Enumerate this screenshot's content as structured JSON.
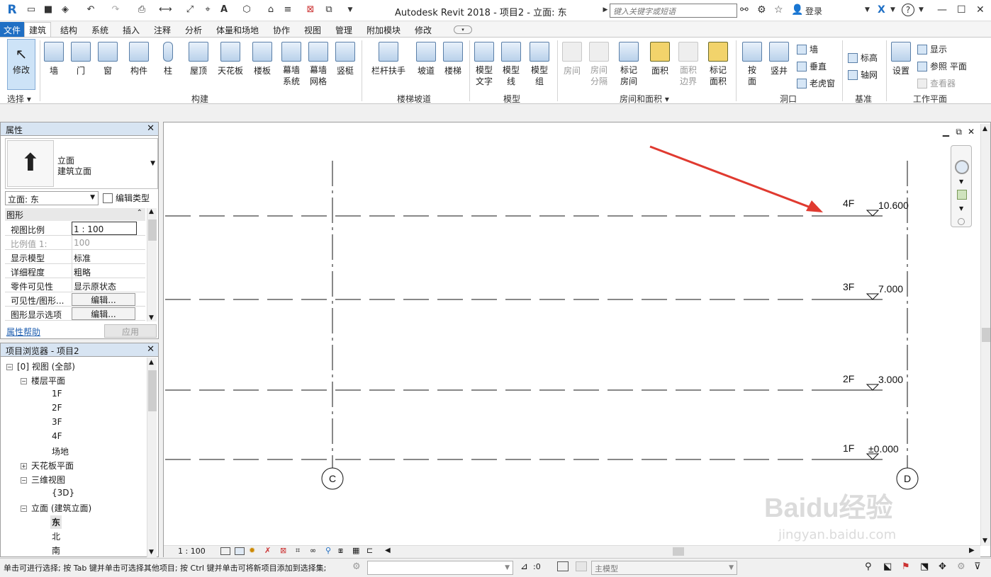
{
  "titlebar": {
    "app_title": "Autodesk Revit 2018 -    项目2 - 立面: 东",
    "search_placeholder": "键入关键字或短语",
    "login": "登录",
    "help": "?"
  },
  "tabs": [
    "文件",
    "建筑",
    "结构",
    "系统",
    "插入",
    "注释",
    "分析",
    "体量和场地",
    "协作",
    "视图",
    "管理",
    "附加模块",
    "修改"
  ],
  "active_tab": "建筑",
  "ribbon": {
    "select": {
      "modify": "修改",
      "label": "选择 ▾"
    },
    "build": {
      "items": [
        "墙",
        "门",
        "窗",
        "构件",
        "柱",
        "屋顶",
        "天花板",
        "楼板",
        "幕墙\n系统",
        "幕墙\n网格",
        "竖梃"
      ],
      "label": "构建"
    },
    "stairs": {
      "items": [
        "栏杆扶手",
        "坡道",
        "楼梯"
      ],
      "label": "楼梯坡道"
    },
    "model": {
      "items": [
        "模型\n文字",
        "模型\n线",
        "模型\n组"
      ],
      "label": "模型"
    },
    "rooms": {
      "items": [
        "房间",
        "房间\n分隔",
        "标记\n房间",
        "面积",
        "面积\n边界",
        "标记\n面积"
      ],
      "label": "房间和面积 ▾"
    },
    "opening": {
      "items": [
        "按\n面",
        "竖井"
      ],
      "small": [
        "墙",
        "垂直",
        "老虎窗"
      ],
      "label": "洞口"
    },
    "datum": {
      "small": [
        "标高",
        "轴网"
      ],
      "label": "基准"
    },
    "workplane": {
      "set": "设置",
      "small": [
        "显示",
        "参照 平面",
        "查看器"
      ],
      "label": "工作平面"
    }
  },
  "properties": {
    "title": "属性",
    "type_line1": "立面",
    "type_line2": "建筑立面",
    "instance": "立面: 东",
    "edit_type": "编辑类型",
    "section": "图形",
    "rows": [
      {
        "k": "视图比例",
        "v": "1 : 100"
      },
      {
        "k": "比例值 1:",
        "v": "100"
      },
      {
        "k": "显示模型",
        "v": "标准"
      },
      {
        "k": "详细程度",
        "v": "粗略"
      },
      {
        "k": "零件可见性",
        "v": "显示原状态"
      },
      {
        "k": "可见性/图形...",
        "v": "编辑..."
      },
      {
        "k": "图形显示选项",
        "v": "编辑..."
      }
    ],
    "help_link": "属性帮助",
    "apply": "应用"
  },
  "browser": {
    "title": "项目浏览器 - 项目2",
    "items": [
      "[0] 视图 (全部)",
      "楼层平面",
      "1F",
      "2F",
      "3F",
      "4F",
      "场地",
      "天花板平面",
      "三维视图",
      "{3D}",
      "立面 (建筑立面)",
      "东",
      "北",
      "南"
    ]
  },
  "drawing": {
    "levels": [
      {
        "name": "4F",
        "elev": "10.600"
      },
      {
        "name": "3F",
        "elev": "7.000"
      },
      {
        "name": "2F",
        "elev": "3.000"
      },
      {
        "name": "1F",
        "elev": "±0.000"
      }
    ],
    "grids": [
      "C",
      "D"
    ],
    "scale": "1 : 100"
  },
  "status": {
    "message": "单击可进行选择; 按 Tab 键并单击可选择其他项目; 按 Ctrl 键并单击可将新项目添加到选择集;",
    "count": ":0",
    "model": "主模型"
  },
  "watermark": {
    "brand": "Baidu经验",
    "url": "jingyan.baidu.com"
  }
}
